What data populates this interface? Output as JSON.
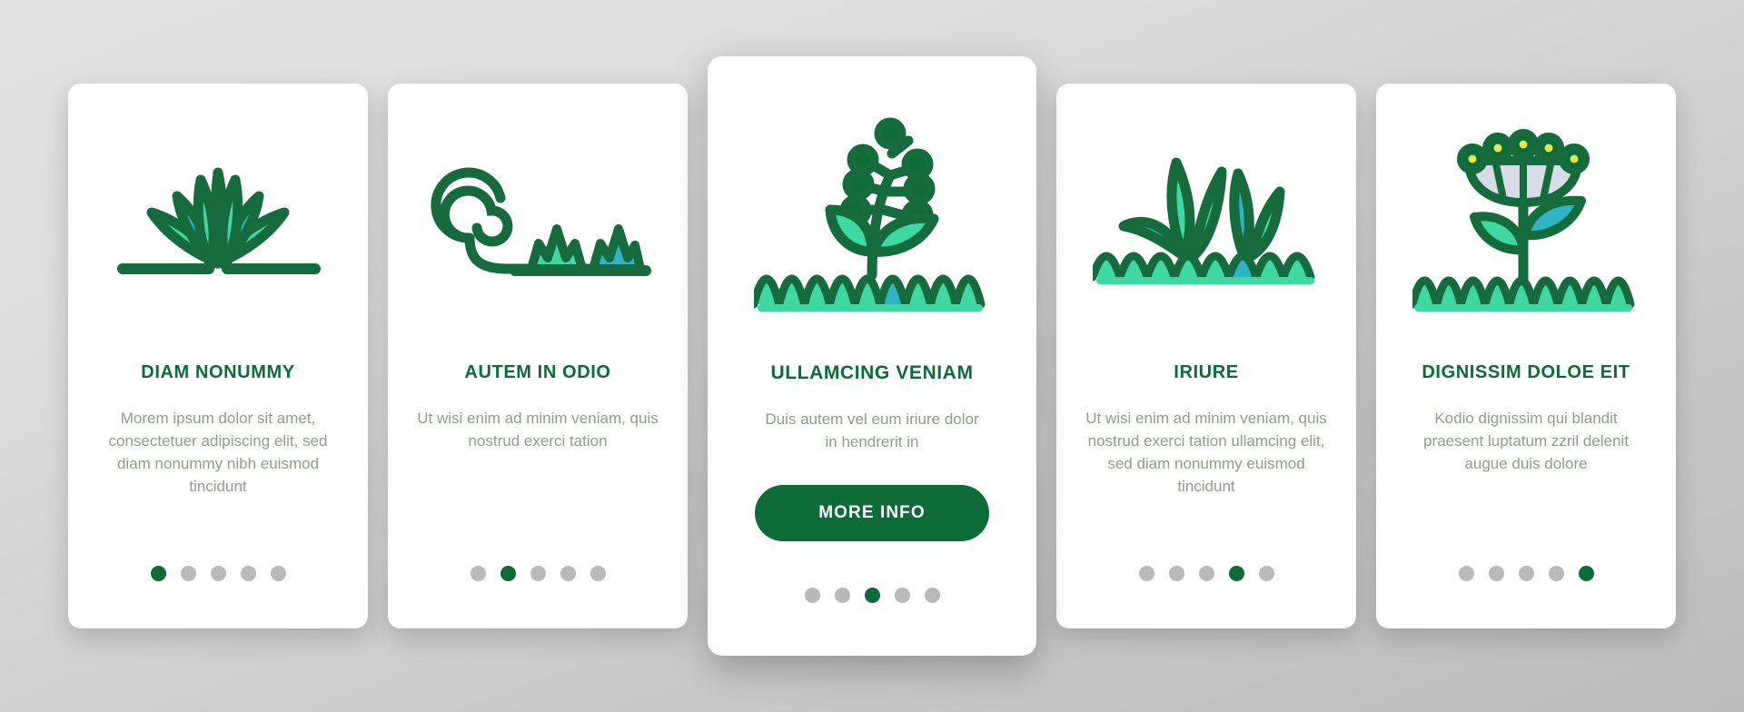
{
  "colors": {
    "brand_dark_green": "#0d6b38",
    "outline_green": "#156b3c",
    "leaf_mint": "#3fd8a0",
    "leaf_teal": "#2fb4c6",
    "body_text": "#8f9c8b",
    "dot_inactive": "#b9b9b9",
    "card_bg": "#ffffff",
    "page_bg": "#d2d2d2"
  },
  "cards": [
    {
      "icon": "grass-tuft-icon",
      "title": "DIAM NONUMMY",
      "body": "Morem ipsum dolor sit amet, consectetuer adipiscing elit, sed diam nonummy nibh euismod tincidunt",
      "dots": {
        "count": 5,
        "active": 1
      },
      "featured": false,
      "button_label": null
    },
    {
      "icon": "fiddlehead-fern-icon",
      "title": "AUTEM IN ODIO",
      "body": "Ut wisi enim ad minim veniam, quis nostrud exerci tation",
      "dots": {
        "count": 5,
        "active": 2
      },
      "featured": false,
      "button_label": null
    },
    {
      "icon": "berry-sprout-icon",
      "title": "ULLAMCING VENIAM",
      "body": "Duis autem vel eum iriure dolor in hendrerit in",
      "dots": {
        "count": 5,
        "active": 3
      },
      "featured": true,
      "button_label": "MORE INFO"
    },
    {
      "icon": "tall-grass-icon",
      "title": "IRIURE",
      "body": "Ut wisi enim ad minim veniam, quis nostrud exerci tation ullamcing elit, sed diam nonummy euismod tincidunt",
      "dots": {
        "count": 5,
        "active": 4
      },
      "featured": false,
      "button_label": null
    },
    {
      "icon": "flower-icon",
      "title": "DIGNISSIM DOLOE EIT",
      "body": "Kodio dignissim qui blandit praesent luptatum zzril delenit augue duis dolore",
      "dots": {
        "count": 5,
        "active": 5
      },
      "featured": false,
      "button_label": null
    }
  ]
}
